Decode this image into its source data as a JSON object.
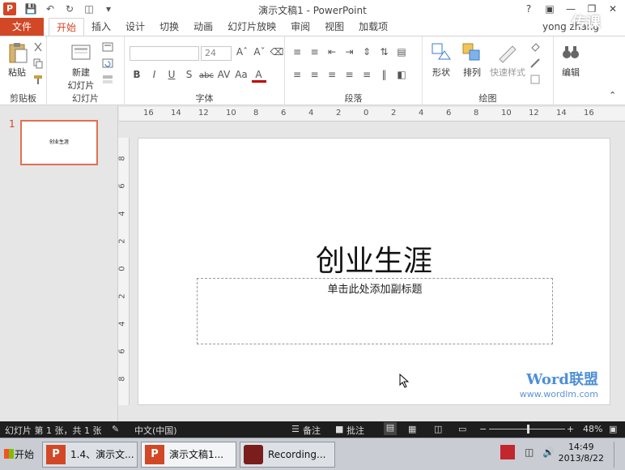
{
  "window": {
    "title": "演示文稿1 - PowerPoint",
    "user": "yong zhang"
  },
  "qat": {
    "app_icon": "P"
  },
  "tabs": {
    "file": "文件",
    "items": [
      "开始",
      "插入",
      "设计",
      "切换",
      "动画",
      "幻灯片放映",
      "审阅",
      "视图",
      "加载项"
    ],
    "active": "开始"
  },
  "ribbon": {
    "clipboard": {
      "paste": "粘贴",
      "label": "剪贴板"
    },
    "slides": {
      "new_slide_1": "新建",
      "new_slide_2": "幻灯片",
      "label": "幻灯片"
    },
    "font": {
      "font_name": "",
      "font_size": "24",
      "label": "字体"
    },
    "paragraph": {
      "label": "段落"
    },
    "drawing": {
      "shapes": "形状",
      "arrange": "排列",
      "quick_styles": "快速样式",
      "label": "绘图"
    },
    "editing": {
      "edit": "编辑"
    }
  },
  "rulers": {
    "horizontal": [
      "16",
      "14",
      "12",
      "10",
      "8",
      "6",
      "4",
      "2",
      "0",
      "2",
      "4",
      "6",
      "8",
      "10",
      "12",
      "14",
      "16"
    ],
    "vertical": [
      "8",
      "6",
      "4",
      "2",
      "0",
      "2",
      "4",
      "6",
      "8"
    ]
  },
  "thumbnails": [
    {
      "number": "1",
      "title": "创业生涯"
    }
  ],
  "slide": {
    "title": "创业生涯",
    "subtitle_placeholder": "单击此处添加副标题"
  },
  "watermark": {
    "brand": "Word联盟",
    "url": "www.wordlm.com",
    "corner": "传课"
  },
  "statusbar": {
    "slide_info": "幻灯片 第 1 张，共 1 张",
    "language": "中文(中国)",
    "notes": "备注",
    "comments": "批注",
    "zoom": "48%",
    "zoom_level": 0.48
  },
  "taskbar": {
    "start": "开始",
    "tasks": [
      "1.4、演示文...",
      "演示文稿1...",
      "Recording..."
    ],
    "time": "14:49",
    "date": "2013/8/22"
  }
}
